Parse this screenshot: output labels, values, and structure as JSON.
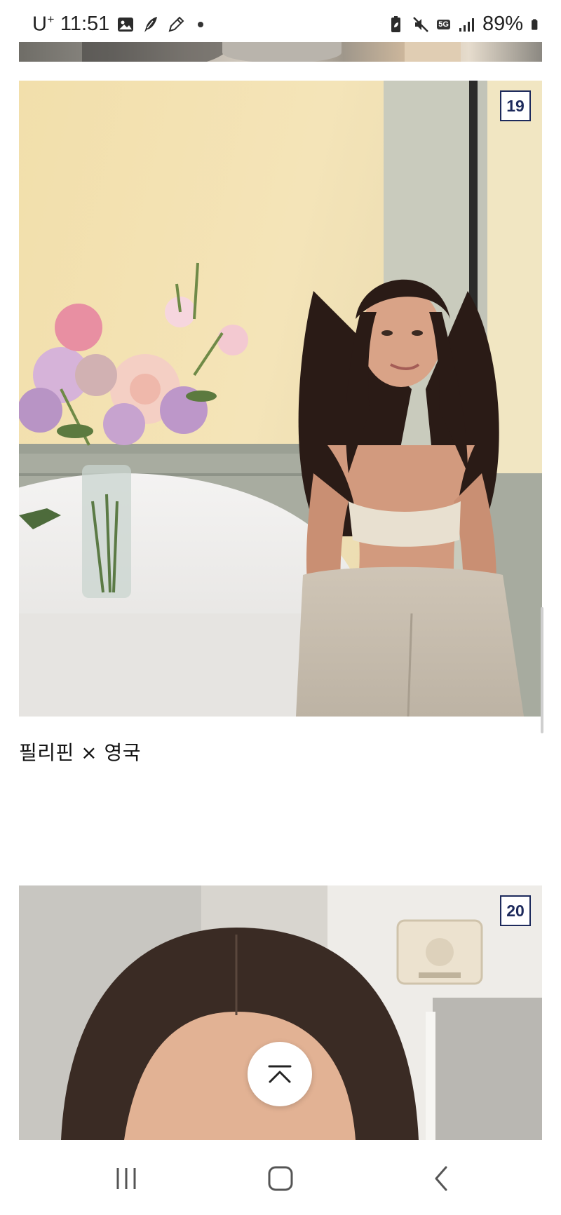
{
  "status_bar": {
    "carrier": "U",
    "carrier_sup": "+",
    "time": "11:51",
    "network": "5G",
    "battery": "89%"
  },
  "cards": [
    {
      "number": "19",
      "caption": "필리핀 × 영국"
    },
    {
      "number": "20"
    }
  ],
  "icons": {
    "gallery": "image-icon",
    "feather": "quill-icon",
    "pencil": "pencil-icon",
    "battery_saver": "battery-saver-icon",
    "mute": "mute-icon",
    "signal": "signal-icon",
    "battery": "battery-icon",
    "scroll_top": "chevron-up-icon",
    "recents": "recents-icon",
    "home": "home-icon",
    "back": "back-icon"
  }
}
